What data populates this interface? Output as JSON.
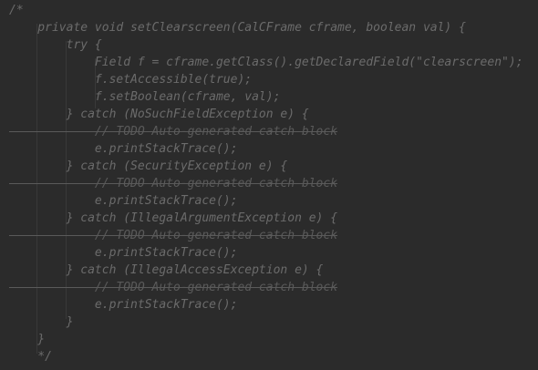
{
  "editor": {
    "lines": [
      "/*",
      "    private void setClearscreen(CalCFrame cframe, boolean val) {",
      "        try {",
      "            Field f = cframe.getClass().getDeclaredField(\"clearscreen\");",
      "            f.setAccessible(true);",
      "            f.setBoolean(cframe, val);",
      "        } catch (NoSuchFieldException e) {",
      "            // TODO Auto-generated catch block",
      "            e.printStackTrace();",
      "        } catch (SecurityException e) {",
      "            // TODO Auto-generated catch block",
      "            e.printStackTrace();",
      "        } catch (IllegalArgumentException e) {",
      "            // TODO Auto-generated catch block",
      "            e.printStackTrace();",
      "        } catch (IllegalAccessException e) {",
      "            // TODO Auto-generated catch block",
      "            e.printStackTrace();",
      "        }",
      "    }",
      "    */"
    ]
  },
  "colors": {
    "background": "#2b2b2b",
    "comment_text": "#6b6b6b",
    "indent_guide": "#393939"
  }
}
